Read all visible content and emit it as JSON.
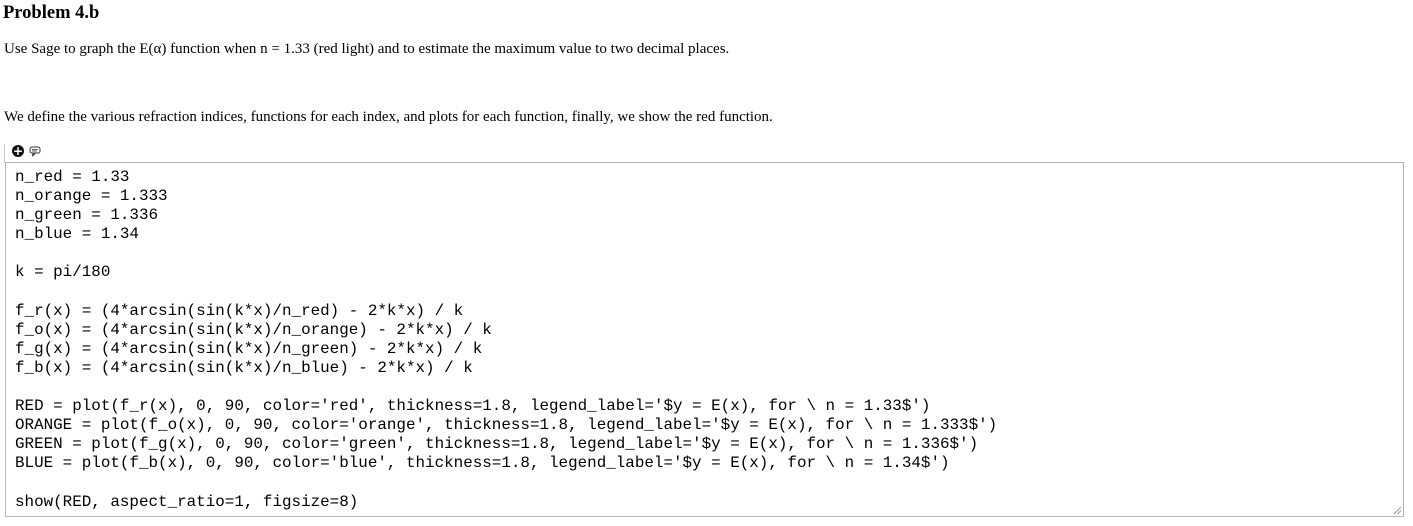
{
  "heading": "Problem 4.b",
  "paragraph_1": "Use Sage to graph the E(α) function when n = 1.33 (red light) and to estimate the maximum value to two decimal places.",
  "paragraph_2": "We define the various refraction indices, functions for each index, and plots for each function, finally, we show the red function.",
  "cell_controls": {
    "add_cell_icon": "plus-circle-icon",
    "add_text_icon": "speech-bubble-icon"
  },
  "code_lines": [
    "n_red = 1.33",
    "n_orange = 1.333",
    "n_green = 1.336",
    "n_blue = 1.34",
    "",
    "k = pi/180",
    "",
    "f_r(x) = (4*arcsin(sin(k*x)/n_red) - 2*k*x) / k",
    "f_o(x) = (4*arcsin(sin(k*x)/n_orange) - 2*k*x) / k",
    "f_g(x) = (4*arcsin(sin(k*x)/n_green) - 2*k*x) / k",
    "f_b(x) = (4*arcsin(sin(k*x)/n_blue) - 2*k*x) / k",
    "",
    "RED = plot(f_r(x), 0, 90, color='red', thickness=1.8, legend_label='$y = E(x), for \\ n = 1.33$')",
    "ORANGE = plot(f_o(x), 0, 90, color='orange', thickness=1.8, legend_label='$y = E(x), for \\ n = 1.333$')",
    "GREEN = plot(f_g(x), 0, 90, color='green', thickness=1.8, legend_label='$y = E(x), for \\ n = 1.336$')",
    "BLUE = plot(f_b(x), 0, 90, color='blue', thickness=1.8, legend_label='$y = E(x), for \\ n = 1.34$')",
    "",
    "show(RED, aspect_ratio=1, figsize=8)"
  ],
  "colors": {
    "cell_border": "#b4b4b4",
    "text": "#000000",
    "background": "#ffffff"
  }
}
